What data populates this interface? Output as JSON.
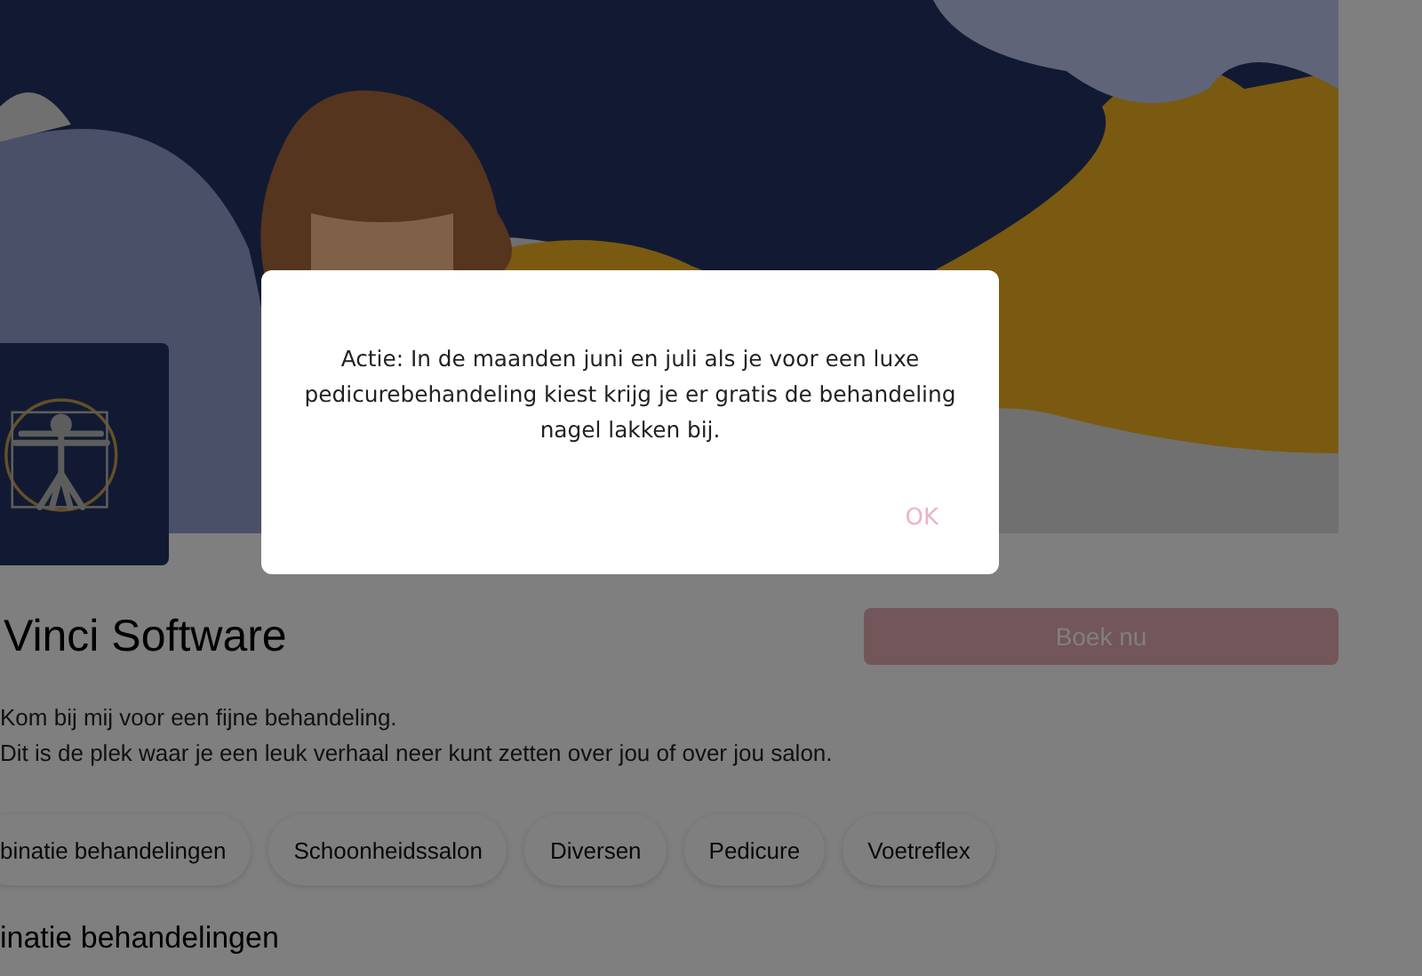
{
  "salon": {
    "name": "Vinci Software",
    "book_button": "Boek nu",
    "description": [
      "Kom bij mij voor een fijne behandeling.",
      "Dit is de plek waar je een leuk verhaal neer kunt zetten over jou of over jou salon."
    ]
  },
  "categories": [
    {
      "label": "binatie behandelingen"
    },
    {
      "label": "Schoonheidssalon"
    },
    {
      "label": "Diversen"
    },
    {
      "label": "Pedicure"
    },
    {
      "label": "Voetreflex"
    }
  ],
  "section_heading": "inatie behandelingen",
  "dialog": {
    "message": "Actie: In de maanden juni en juli als je voor een luxe pedicurebehandeling kiest krijg je er gratis de behandeling nagel lakken bij.",
    "button": "OK"
  }
}
